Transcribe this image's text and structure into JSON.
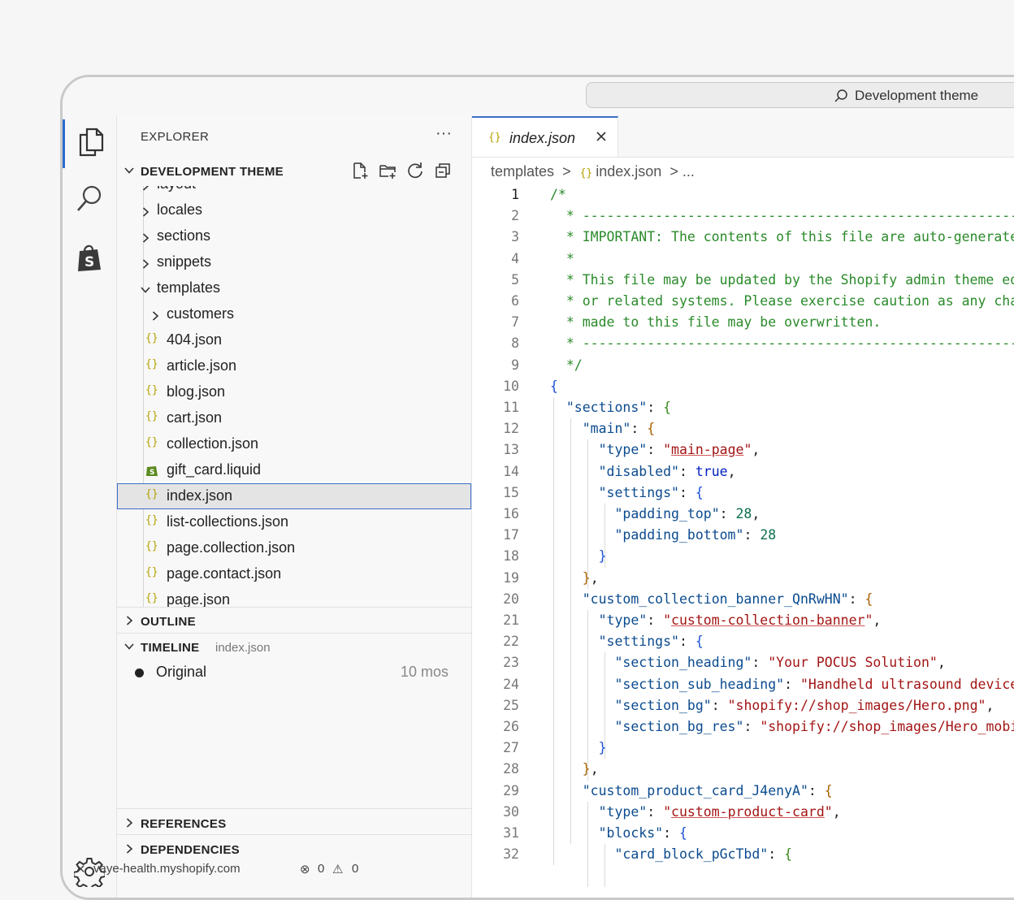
{
  "titlebar": {
    "command_center": "Development theme"
  },
  "explorer": {
    "title": "EXPLORER",
    "more": "···",
    "workspace": "DEVELOPMENT THEME",
    "tree": [
      {
        "name": "layout",
        "type": "folder",
        "expanded": false,
        "depth": 0
      },
      {
        "name": "locales",
        "type": "folder",
        "expanded": false,
        "depth": 0
      },
      {
        "name": "sections",
        "type": "folder",
        "expanded": false,
        "depth": 0
      },
      {
        "name": "snippets",
        "type": "folder",
        "expanded": false,
        "depth": 0
      },
      {
        "name": "templates",
        "type": "folder",
        "expanded": true,
        "depth": 0
      },
      {
        "name": "customers",
        "type": "folder",
        "expanded": false,
        "depth": 1
      },
      {
        "name": "404.json",
        "type": "json",
        "depth": 1
      },
      {
        "name": "article.json",
        "type": "json",
        "depth": 1
      },
      {
        "name": "blog.json",
        "type": "json",
        "depth": 1
      },
      {
        "name": "cart.json",
        "type": "json",
        "depth": 1
      },
      {
        "name": "collection.json",
        "type": "json",
        "depth": 1
      },
      {
        "name": "gift_card.liquid",
        "type": "liquid",
        "depth": 1
      },
      {
        "name": "index.json",
        "type": "json",
        "depth": 1,
        "selected": true
      },
      {
        "name": "list-collections.json",
        "type": "json",
        "depth": 1
      },
      {
        "name": "page.collection.json",
        "type": "json",
        "depth": 1
      },
      {
        "name": "page.contact.json",
        "type": "json",
        "depth": 1
      },
      {
        "name": "page.json",
        "type": "json",
        "depth": 1
      }
    ],
    "outline": "OUTLINE",
    "timeline": {
      "label": "TIMELINE",
      "file": "index.json",
      "entry": "Original",
      "age": "10 mos"
    },
    "references": "REFERENCES",
    "dependencies": "DEPENDENCIES"
  },
  "editor": {
    "tab": {
      "icon": "{}",
      "name": "index.json"
    },
    "breadcrumb": {
      "folder": "templates",
      "file": "index.json",
      "more": "..."
    },
    "lines": [
      [
        [
          "c-com",
          "/*"
        ]
      ],
      [
        [
          "c-com",
          "  * ------------------------------------------------------------"
        ]
      ],
      [
        [
          "c-com",
          "  * IMPORTANT: The contents of this file are auto-generated."
        ]
      ],
      [
        [
          "c-com",
          "  *"
        ]
      ],
      [
        [
          "c-com",
          "  * This file may be updated by the Shopify admin theme editor"
        ]
      ],
      [
        [
          "c-com",
          "  * or related systems. Please exercise caution as any changes"
        ]
      ],
      [
        [
          "c-com",
          "  * made to this file may be overwritten."
        ]
      ],
      [
        [
          "c-com",
          "  * ------------------------------------------------------------"
        ]
      ],
      [
        [
          "c-com",
          "  */"
        ]
      ],
      [
        [
          "c-b1",
          "{"
        ]
      ],
      [
        [
          "",
          "  "
        ],
        [
          "c-key",
          "\"sections\""
        ],
        [
          "",
          ": "
        ],
        [
          "c-b2",
          "{"
        ]
      ],
      [
        [
          "",
          "    "
        ],
        [
          "c-key",
          "\"main\""
        ],
        [
          "",
          ": "
        ],
        [
          "c-b3",
          "{"
        ]
      ],
      [
        [
          "",
          "      "
        ],
        [
          "c-key",
          "\"type\""
        ],
        [
          "",
          ": "
        ],
        [
          "c-plainstr",
          "\""
        ],
        [
          "c-str",
          "main-page"
        ],
        [
          "c-plainstr",
          "\""
        ],
        [
          "",
          ","
        ]
      ],
      [
        [
          "",
          "      "
        ],
        [
          "c-key",
          "\"disabled\""
        ],
        [
          "",
          ": "
        ],
        [
          "c-bool",
          "true"
        ],
        [
          "",
          ","
        ]
      ],
      [
        [
          "",
          "      "
        ],
        [
          "c-key",
          "\"settings\""
        ],
        [
          "",
          ": "
        ],
        [
          "c-b1",
          "{"
        ]
      ],
      [
        [
          "",
          "        "
        ],
        [
          "c-key",
          "\"padding_top\""
        ],
        [
          "",
          ": "
        ],
        [
          "c-num",
          "28"
        ],
        [
          "",
          ","
        ]
      ],
      [
        [
          "",
          "        "
        ],
        [
          "c-key",
          "\"padding_bottom\""
        ],
        [
          "",
          ": "
        ],
        [
          "c-num",
          "28"
        ]
      ],
      [
        [
          "",
          "      "
        ],
        [
          "c-b1",
          "}"
        ]
      ],
      [
        [
          "",
          "    "
        ],
        [
          "c-b3",
          "}"
        ],
        [
          "",
          ","
        ]
      ],
      [
        [
          "",
          "    "
        ],
        [
          "c-key",
          "\"custom_collection_banner_QnRwHN\""
        ],
        [
          "",
          ": "
        ],
        [
          "c-b3",
          "{"
        ]
      ],
      [
        [
          "",
          "      "
        ],
        [
          "c-key",
          "\"type\""
        ],
        [
          "",
          ": "
        ],
        [
          "c-plainstr",
          "\""
        ],
        [
          "c-str",
          "custom-collection-banner"
        ],
        [
          "c-plainstr",
          "\""
        ],
        [
          "",
          ","
        ]
      ],
      [
        [
          "",
          "      "
        ],
        [
          "c-key",
          "\"settings\""
        ],
        [
          "",
          ": "
        ],
        [
          "c-b1",
          "{"
        ]
      ],
      [
        [
          "",
          "        "
        ],
        [
          "c-key",
          "\"section_heading\""
        ],
        [
          "",
          ": "
        ],
        [
          "c-plainstr",
          "\"Your POCUS Solution\""
        ],
        [
          "",
          ","
        ]
      ],
      [
        [
          "",
          "        "
        ],
        [
          "c-key",
          "\"section_sub_heading\""
        ],
        [
          "",
          ": "
        ],
        [
          "c-plainstr",
          "\"Handheld ultrasound devices\""
        ],
        [
          "",
          ","
        ]
      ],
      [
        [
          "",
          "        "
        ],
        [
          "c-key",
          "\"section_bg\""
        ],
        [
          "",
          ": "
        ],
        [
          "c-plainstr",
          "\"shopify://shop_images/Hero.png\""
        ],
        [
          "",
          ","
        ]
      ],
      [
        [
          "",
          "        "
        ],
        [
          "c-key",
          "\"section_bg_res\""
        ],
        [
          "",
          ": "
        ],
        [
          "c-plainstr",
          "\"shopify://shop_images/Hero_mobile.png\""
        ]
      ],
      [
        [
          "",
          "      "
        ],
        [
          "c-b1",
          "}"
        ]
      ],
      [
        [
          "",
          "    "
        ],
        [
          "c-b3",
          "}"
        ],
        [
          "",
          ","
        ]
      ],
      [
        [
          "",
          "    "
        ],
        [
          "c-key",
          "\"custom_product_card_J4enyA\""
        ],
        [
          "",
          ": "
        ],
        [
          "c-b3",
          "{"
        ]
      ],
      [
        [
          "",
          "      "
        ],
        [
          "c-key",
          "\"type\""
        ],
        [
          "",
          ": "
        ],
        [
          "c-plainstr",
          "\""
        ],
        [
          "c-str",
          "custom-product-card"
        ],
        [
          "c-plainstr",
          "\""
        ],
        [
          "",
          ","
        ]
      ],
      [
        [
          "",
          "      "
        ],
        [
          "c-key",
          "\"blocks\""
        ],
        [
          "",
          ": "
        ],
        [
          "c-b1",
          "{"
        ]
      ],
      [
        [
          "",
          "        "
        ],
        [
          "c-key",
          "\"card_block_pGcTbd\""
        ],
        [
          "",
          ": "
        ],
        [
          "c-b2",
          "{"
        ]
      ]
    ]
  },
  "statusbar": {
    "remote": "vaye-health.myshopify.com",
    "errors": "0",
    "warnings": "0"
  }
}
